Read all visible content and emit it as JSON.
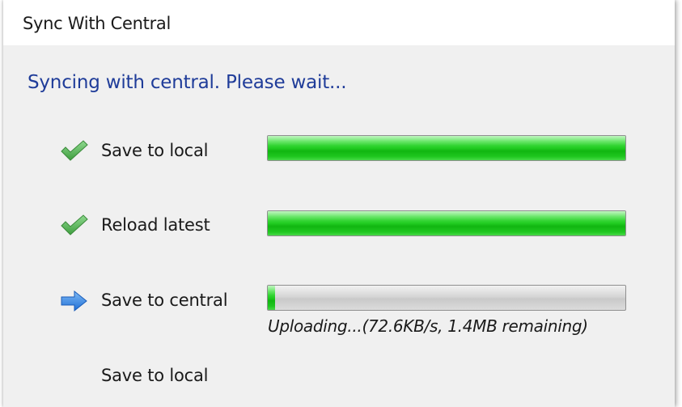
{
  "window": {
    "title": "Sync With Central"
  },
  "status_heading": "Syncing with central. Please wait...",
  "steps": [
    {
      "label": "Save to local",
      "icon": "check-icon",
      "state": "done",
      "progress": 1.0
    },
    {
      "label": "Reload latest",
      "icon": "check-icon",
      "state": "done",
      "progress": 1.0
    },
    {
      "label": "Save to central",
      "icon": "arrow-right-icon",
      "state": "active",
      "progress": 0.02,
      "status": "Uploading...(72.6KB/s, 1.4MB remaining)"
    },
    {
      "label": "Save to local",
      "icon": null,
      "state": "pending"
    }
  ],
  "colors": {
    "heading": "#1f3c99",
    "progress_fill": "#22cc22",
    "check": "#5cb85c",
    "arrow": "#2f7fe0"
  }
}
